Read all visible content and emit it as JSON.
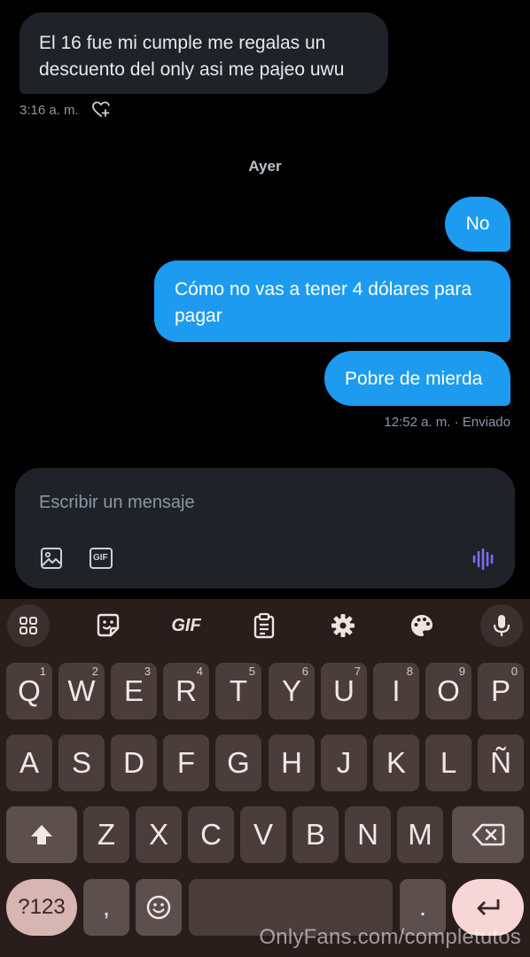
{
  "chat": {
    "incoming": {
      "text": "El 16 fue mi cumple me regalas un descuento del only asi me pajeo uwu",
      "time": "3:16 a. m."
    },
    "day_separator": "Ayer",
    "outgoing": [
      {
        "text": "No"
      },
      {
        "text": "Cómo no vas a tener 4 dólares para pagar"
      },
      {
        "text": "Pobre de mierda"
      }
    ],
    "sent_meta": "12:52 a. m. · Enviado",
    "colors": {
      "bubble_out": "#1d9bf0",
      "bubble_in": "#1f2328",
      "voice_icon": "#7b6cf6"
    }
  },
  "composer": {
    "placeholder": "Escribir un mensaje",
    "gif_label": "GIF"
  },
  "keyboard": {
    "toolbar": [
      "apps-icon",
      "sticker-icon",
      "gif",
      "clipboard-icon",
      "settings-icon",
      "palette-icon",
      "mic-icon"
    ],
    "gif_label": "GIF",
    "row1": [
      {
        "key": "Q",
        "hint": "1"
      },
      {
        "key": "W",
        "hint": "2"
      },
      {
        "key": "E",
        "hint": "3"
      },
      {
        "key": "R",
        "hint": "4"
      },
      {
        "key": "T",
        "hint": "5"
      },
      {
        "key": "Y",
        "hint": "6"
      },
      {
        "key": "U",
        "hint": "7"
      },
      {
        "key": "I",
        "hint": "8"
      },
      {
        "key": "O",
        "hint": "9"
      },
      {
        "key": "P",
        "hint": "0"
      }
    ],
    "row2": [
      "A",
      "S",
      "D",
      "F",
      "G",
      "H",
      "J",
      "K",
      "L",
      "Ñ"
    ],
    "row3": [
      "Z",
      "X",
      "C",
      "V",
      "B",
      "N",
      "M"
    ],
    "symbols_label": "?123",
    "comma": ",",
    "period": ".",
    "colors": {
      "key": "#4a3d3b",
      "background": "#2a1e1d",
      "symbols_pill": "#d7b5b3",
      "enter": "#f6d6d6"
    }
  },
  "watermark": "OnlyFans.com/completutos"
}
